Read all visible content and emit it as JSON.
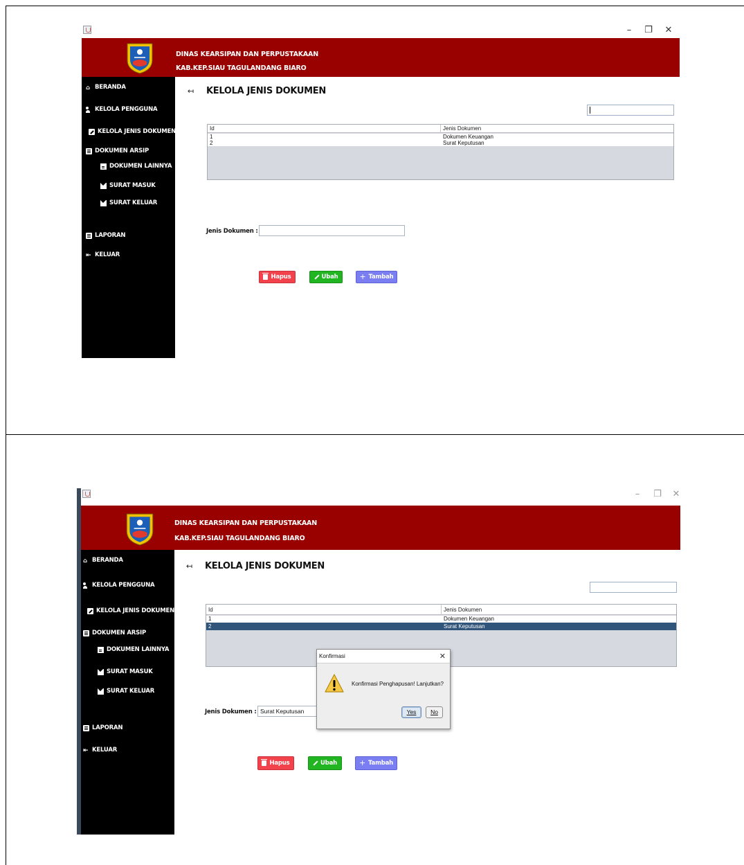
{
  "window": {
    "minimize": "–",
    "maximize": "❐",
    "close": "✕"
  },
  "header": {
    "line1": "DINAS KEARSIPAN DAN PERPUSTAKAAN",
    "line2": "KAB.KEP.SIAU TAGULANDANG BIARO"
  },
  "sidebar": {
    "items": [
      {
        "label": "BERANDA",
        "icon": "home-icon"
      },
      {
        "label": "KELOLA PENGGUNA",
        "icon": "users-icon"
      },
      {
        "label": "KELOLA JENIS DOKUMEN",
        "icon": "edit-icon"
      },
      {
        "label": "DOKUMEN ARSIP",
        "icon": "archive-icon"
      },
      {
        "label": "DOKUMEN LAINNYA",
        "icon": "file-icon"
      },
      {
        "label": "SURAT MASUK",
        "icon": "envelope-icon"
      },
      {
        "label": "SURAT KELUAR",
        "icon": "envelope-icon"
      },
      {
        "label": "LAPORAN",
        "icon": "report-icon"
      },
      {
        "label": "KELUAR",
        "icon": "logout-icon"
      }
    ]
  },
  "main": {
    "title": "KELOLA JENIS DOKUMEN",
    "table": {
      "columns": [
        "Id",
        "Jenis Dokumen"
      ],
      "rows": [
        {
          "id": "1",
          "jenis": "Dokumen Keuangan"
        },
        {
          "id": "2",
          "jenis": "Surat Keputusan"
        }
      ]
    },
    "field_label": "Jenis Dokumen :",
    "buttons": {
      "hapus": "Hapus",
      "ubah": "Ubah",
      "tambah": "Tambah"
    }
  },
  "screen1": {
    "search_value": "",
    "jenis_value": ""
  },
  "screen2": {
    "search_value": "",
    "jenis_value": "Surat Keputusan",
    "selected_row": 2,
    "dialog": {
      "title": "Konfirmasi",
      "message": "Konfirmasi Penghapusan! Lanjutkan?",
      "yes": "Yes",
      "no": "No"
    }
  },
  "colors": {
    "header": "#990000",
    "sidebar": "#000000",
    "selected_row": "#31557a",
    "hapus": "#f2424c",
    "ubah": "#22b522",
    "tambah": "#7b7ef0"
  }
}
